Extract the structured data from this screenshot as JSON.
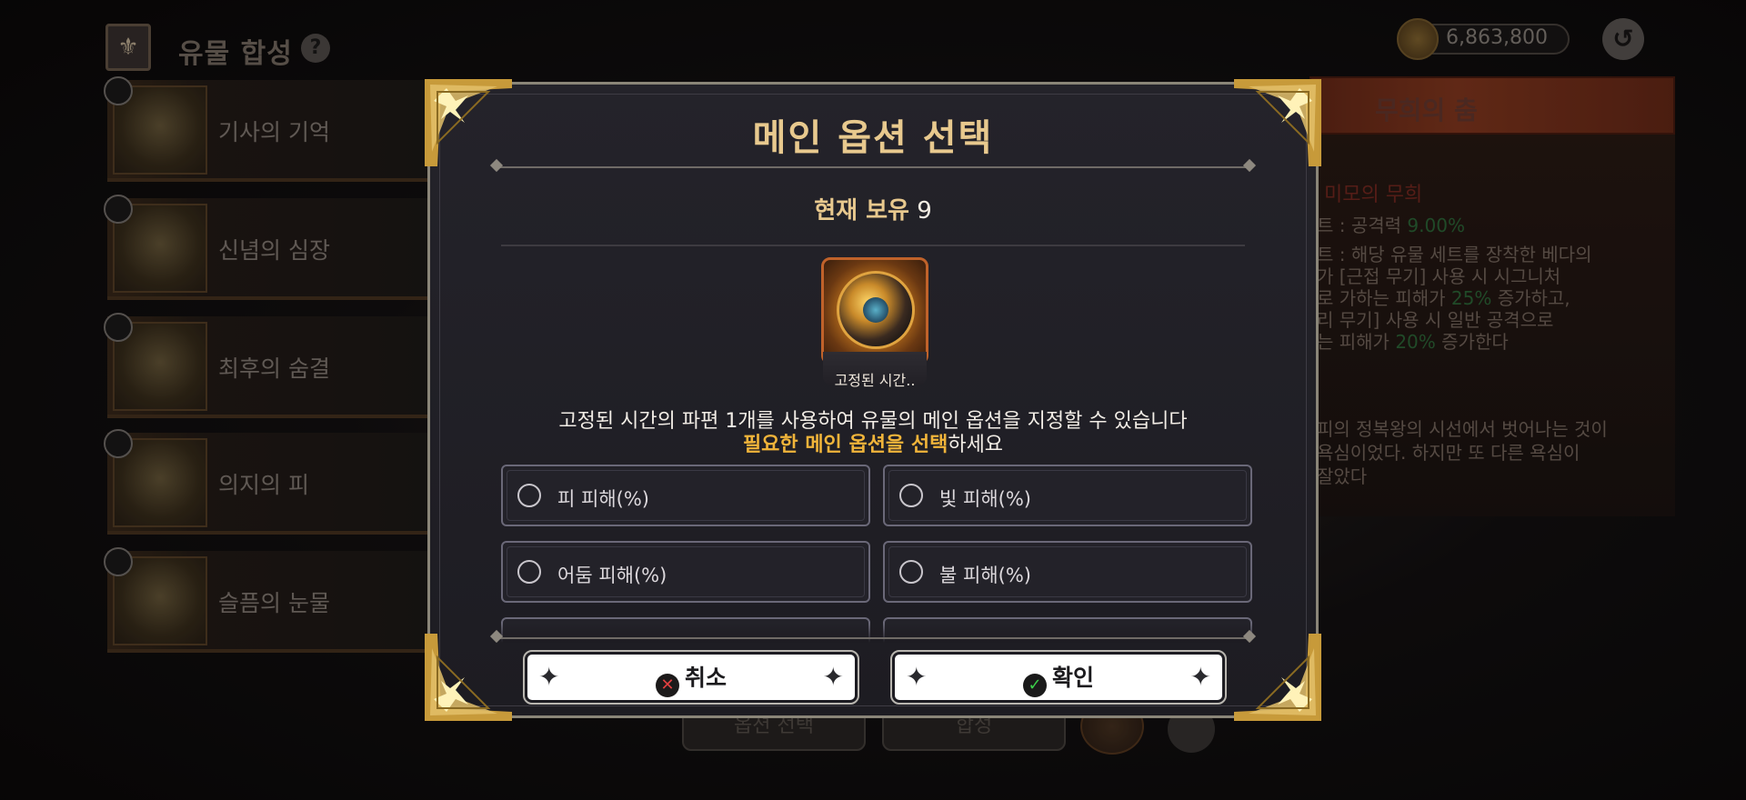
{
  "background": {
    "title": "유물 합성",
    "help_icon": "?",
    "gold": "6,863,800",
    "list_items": [
      {
        "label": "기사의 기억"
      },
      {
        "label": "신념의 심장"
      },
      {
        "label": "최후의 숨결"
      },
      {
        "label": "의지의 피"
      },
      {
        "label": "슬픔의 눈물"
      }
    ],
    "detail": {
      "banner_title": "무희의 춤",
      "subtitle": "미모의 무희",
      "line1_prefix": "트 : 공격력",
      "line1_value": "9.00%",
      "line2": "트 : 해당 유물 세트를 장착한 베다의",
      "line3": "가 [근접 무기] 사용 시 시그니처",
      "line4_prefix": "로 가하는 피해가",
      "line4_value": "25%",
      "line4_suffix": "증가하고,",
      "line5": "리 무기] 사용 시 일반 공격으로",
      "line6_prefix": "는 피해가",
      "line6_value": "20%",
      "line6_suffix": "증가한다",
      "lore1": "피의 정복왕의 시선에서 벗어나는 것이",
      "lore2": "욕심이었다. 하지만 또 다른 욕심이",
      "lore3": "잘았다"
    },
    "bottom_buttons": [
      "옵션 선택",
      "합성"
    ]
  },
  "modal": {
    "title": "메인 옵션 선택",
    "holding_label": "현재 보유",
    "holding_count": "9",
    "item_caption": "고정된 시간..",
    "description_line1": "고정된 시간의 파편 1개를 사용하여 유물의 메인 옵션을 지정할 수 있습니다",
    "description_highlight": "필요한 메인 옵션을 선택",
    "description_suffix": "하세요",
    "options": [
      {
        "label": "피 피해(%)",
        "selected": false
      },
      {
        "label": "빛 피해(%)",
        "selected": false
      },
      {
        "label": "어둠 피해(%)",
        "selected": false
      },
      {
        "label": "불 피해(%)",
        "selected": false
      }
    ],
    "cancel_label": "취소",
    "confirm_label": "확인",
    "cancel_icon": "x-circle-icon",
    "confirm_icon": "check-circle-icon"
  },
  "colors": {
    "accent_gold": "#e8c98e",
    "highlight_orange": "#f0b43a",
    "modal_bg": "#1d1c22"
  }
}
